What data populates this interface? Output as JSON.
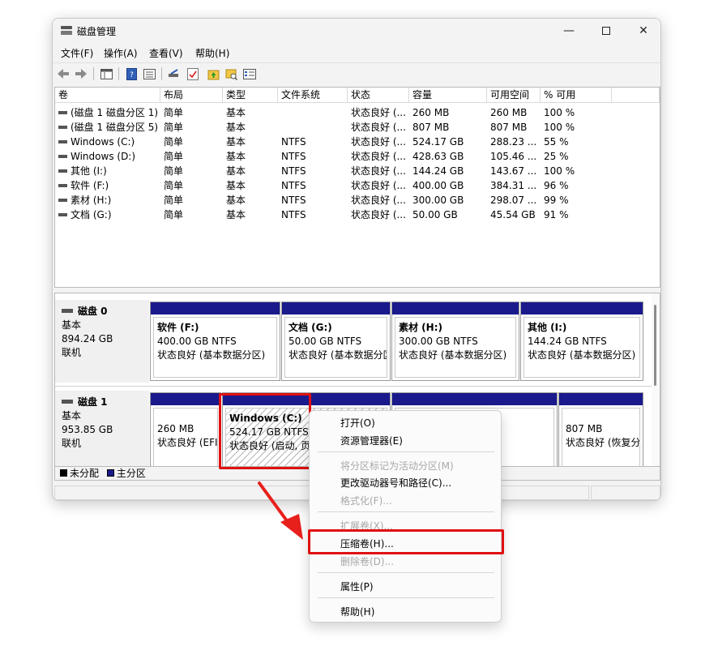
{
  "window": {
    "title": "磁盘管理",
    "min_glyph": "—",
    "close_glyph": "✕"
  },
  "menu": [
    "文件(F)",
    "操作(A)",
    "查看(V)",
    "帮助(H)"
  ],
  "toolbar": {
    "icons": [
      "back-arrow-icon",
      "forward-arrow-icon",
      "view-pane-icon",
      "help-book-icon",
      "properties-list-icon",
      "connect-disk-icon",
      "checklist-icon",
      "folder-up-icon",
      "folder-search-icon",
      "details-pane-icon"
    ]
  },
  "table": {
    "headers": [
      "卷",
      "布局",
      "类型",
      "文件系统",
      "状态",
      "容量",
      "可用空间",
      "% 可用"
    ],
    "rows": [
      [
        "(磁盘 1 磁盘分区 1)",
        "简单",
        "基本",
        "",
        "状态良好 (...",
        "260 MB",
        "260 MB",
        "100 %"
      ],
      [
        "(磁盘 1 磁盘分区 5)",
        "简单",
        "基本",
        "",
        "状态良好 (...",
        "807 MB",
        "807 MB",
        "100 %"
      ],
      [
        "Windows (C:)",
        "简单",
        "基本",
        "NTFS",
        "状态良好 (...",
        "524.17 GB",
        "288.23 ...",
        "55 %"
      ],
      [
        "Windows (D:)",
        "简单",
        "基本",
        "NTFS",
        "状态良好 (...",
        "428.63 GB",
        "105.46 ...",
        "25 %"
      ],
      [
        "其他 (I:)",
        "简单",
        "基本",
        "NTFS",
        "状态良好 (...",
        "144.24 GB",
        "143.67 ...",
        "100 %"
      ],
      [
        "软件 (F:)",
        "简单",
        "基本",
        "NTFS",
        "状态良好 (...",
        "400.00 GB",
        "384.31 ...",
        "96 %"
      ],
      [
        "素材 (H:)",
        "简单",
        "基本",
        "NTFS",
        "状态良好 (...",
        "300.00 GB",
        "298.07 ...",
        "99 %"
      ],
      [
        "文档 (G:)",
        "简单",
        "基本",
        "NTFS",
        "状态良好 (...",
        "50.00 GB",
        "45.54 GB",
        "91 %"
      ]
    ]
  },
  "disks": [
    {
      "name": "磁盘 0",
      "type": "基本",
      "size": "894.24 GB",
      "state": "联机",
      "partitions": [
        {
          "name": "软件 (F:)",
          "size": "400.00 GB NTFS",
          "status": "状态良好 (基本数据分区)"
        },
        {
          "name": "文档 (G:)",
          "size": "50.00 GB NTFS",
          "status": "状态良好 (基本数据分区)"
        },
        {
          "name": "素材 (H:)",
          "size": "300.00 GB NTFS",
          "status": "状态良好 (基本数据分区)"
        },
        {
          "name": "其他 (I:)",
          "size": "144.24 GB NTFS",
          "status": "状态良好 (基本数据分区)"
        }
      ]
    },
    {
      "name": "磁盘 1",
      "type": "基本",
      "size": "953.85 GB",
      "state": "联机",
      "partitions": [
        {
          "name": "",
          "size": "260 MB",
          "status": "状态良好 (EFI"
        },
        {
          "name": "Windows (C:)",
          "size": "524.17 GB NTFS",
          "status": "状态良好 (启动, 页面"
        },
        {
          "name": "",
          "size": "",
          "status": ""
        },
        {
          "name": "",
          "size": "807 MB",
          "status": "状态良好 (恢复分"
        }
      ]
    }
  ],
  "legend": {
    "unallocated": "未分配",
    "primary": "主分区",
    "unallocated_color": "#000000",
    "primary_color": "#1a1a8c"
  },
  "context_menu": {
    "items": [
      {
        "label": "打开(O)",
        "enabled": true
      },
      {
        "label": "资源管理器(E)",
        "enabled": true
      },
      {
        "label": "将分区标记为活动分区(M)",
        "enabled": false
      },
      {
        "label": "更改驱动器号和路径(C)...",
        "enabled": true
      },
      {
        "label": "格式化(F)...",
        "enabled": false
      },
      {
        "label": "扩展卷(X)...",
        "enabled": false
      },
      {
        "label": "压缩卷(H)...",
        "enabled": true
      },
      {
        "label": "删除卷(D)...",
        "enabled": false
      },
      {
        "label": "属性(P)",
        "enabled": true
      },
      {
        "label": "帮助(H)",
        "enabled": true
      }
    ]
  },
  "colors": {
    "partition_bar": "#1a1a8c",
    "highlight": "#e01010",
    "arrow": "#e8201c"
  }
}
